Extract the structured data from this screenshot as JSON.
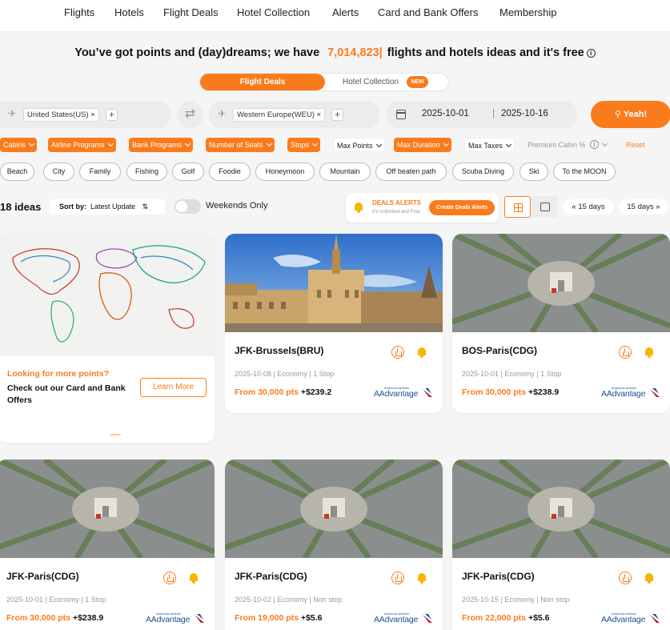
{
  "nav": [
    "Flights",
    "Hotels",
    "Flight Deals",
    "Hotel Collection",
    "Alerts",
    "Card and Bank Offers",
    "Membership"
  ],
  "headline": {
    "prefix": "You’ve got points and (day)dreams; we have",
    "count": "7,014,823|",
    "suffix": "flights and hotels ideas and it's free"
  },
  "mode": {
    "active": "Flight Deals",
    "inactive": "Hotel Collection",
    "badge": "NEW"
  },
  "search": {
    "origin_chip": "United States(US)",
    "destination_chip": "Western Europe(WEU)",
    "depart_date": "2025-10-01",
    "return_date": "2025-10-16",
    "submit": "Yeah!"
  },
  "filters": {
    "active": [
      "Cabins",
      "Airline Programs",
      "Bank Programs",
      "Number of Seats",
      "Stops"
    ],
    "max_points": "Max Points",
    "max_duration": "Max Duration",
    "max_taxes": "Max Taxes",
    "premium_cabin": "Premium Cabin %",
    "reset": "Reset"
  },
  "tags": [
    "Beach",
    "City",
    "Family",
    "Fishing",
    "Golf",
    "Foodie",
    "Honeymoon",
    "Mountain",
    "Off beaten path",
    "Scuba Diving",
    "Ski",
    "To the MOON"
  ],
  "results": {
    "count": "18 ideas",
    "sort_label": "Sort by:",
    "sort_value": "Latest Update",
    "weekends": "Weekends Only",
    "alerts_title": "DEALS ALERTS",
    "alerts_sub": "It's Unlimited and Free",
    "alerts_button": "Create Deals Alerts",
    "prev": "« 15 days",
    "next": "15 days »"
  },
  "promo": {
    "title": "Looking for more points?",
    "text": "Check out our Card and Bank Offers",
    "button": "Learn More"
  },
  "airline_logo": {
    "small": "American Airlines",
    "name": "AAdvantage"
  },
  "cards": [
    {
      "route": "JFK-Brussels(BRU)",
      "meta": "2025-10-08 | Economy | 1 Stop",
      "points": "From 30,000 pts",
      "tax": "+$239.2",
      "image": "brussels"
    },
    {
      "route": "BOS-Paris(CDG)",
      "meta": "2025-10-01 | Economy | 1 Stop",
      "points": "From 30,000 pts",
      "tax": "+$238.9",
      "image": "paris"
    },
    {
      "route": "JFK-Paris(CDG)",
      "meta": "2025-10-01 | Economy | 1 Stop",
      "points": "From 30,000 pts",
      "tax": "+$238.9",
      "image": "paris"
    },
    {
      "route": "JFK-Paris(CDG)",
      "meta": "2025-10-02 | Economy | Non stop",
      "points": "From 19,000 pts",
      "tax": "+$5.6",
      "image": "paris"
    },
    {
      "route": "JFK-Paris(CDG)",
      "meta": "2025-10-15 | Economy | Non stop",
      "points": "From 22,000 pts",
      "tax": "+$5.6",
      "image": "paris"
    }
  ],
  "colors": {
    "accent": "#fa7b1c",
    "background": "#f5f5f5",
    "bell": "#f7b500"
  }
}
